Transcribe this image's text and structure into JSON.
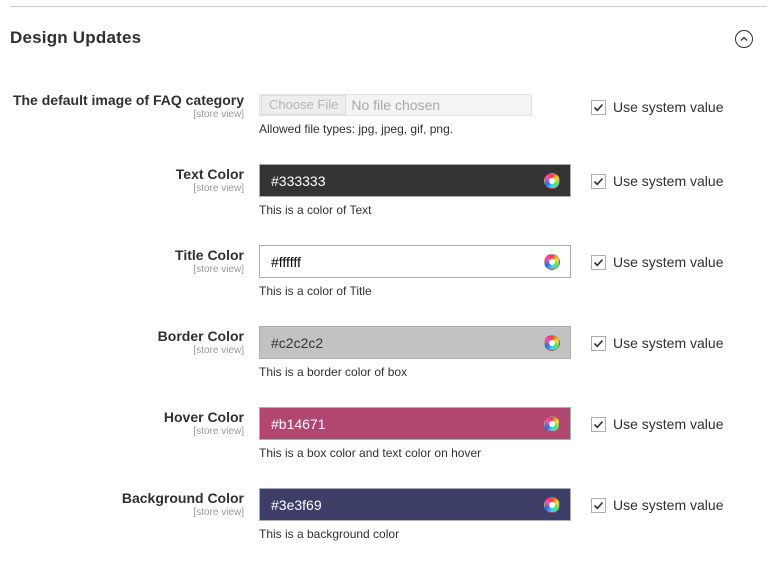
{
  "section": {
    "title": "Design Updates"
  },
  "fields": {
    "default_image": {
      "label": "The default image of FAQ category",
      "scope": "[store view]",
      "button": "Choose File",
      "file_status": "No file chosen",
      "note": "Allowed file types: jpg, jpeg, gif, png.",
      "use_system_value": "Use system value",
      "checked": true
    },
    "text_color": {
      "label": "Text Color",
      "scope": "[store view]",
      "value": "#333333",
      "bg": "#333333",
      "fg": "#ffffff",
      "note": "This is a color of Text",
      "use_system_value": "Use system value",
      "checked": true
    },
    "title_color": {
      "label": "Title Color",
      "scope": "[store view]",
      "value": "#ffffff",
      "bg": "#ffffff",
      "fg": "#000000",
      "note": "This is a color of Title",
      "use_system_value": "Use system value",
      "checked": true
    },
    "border_color": {
      "label": "Border Color",
      "scope": "[store view]",
      "value": "#c2c2c2",
      "bg": "#c2c2c2",
      "fg": "#333333",
      "note": "This is a border color of box",
      "use_system_value": "Use system value",
      "checked": true
    },
    "hover_color": {
      "label": "Hover Color",
      "scope": "[store view]",
      "value": "#b14671",
      "bg": "#b14671",
      "fg": "#ffffff",
      "note": "This is a box color and text color on hover",
      "use_system_value": "Use system value",
      "checked": true
    },
    "background_color": {
      "label": "Background Color",
      "scope": "[store view]",
      "value": "#3e3f69",
      "bg": "#3e3f69",
      "fg": "#ffffff",
      "note": "This is a background color",
      "use_system_value": "Use system value",
      "checked": true
    }
  },
  "icons": {
    "collapse": "chevron-up-circle-icon",
    "color_picker": "color-wheel-icon",
    "checkbox": "checkmark-icon"
  }
}
